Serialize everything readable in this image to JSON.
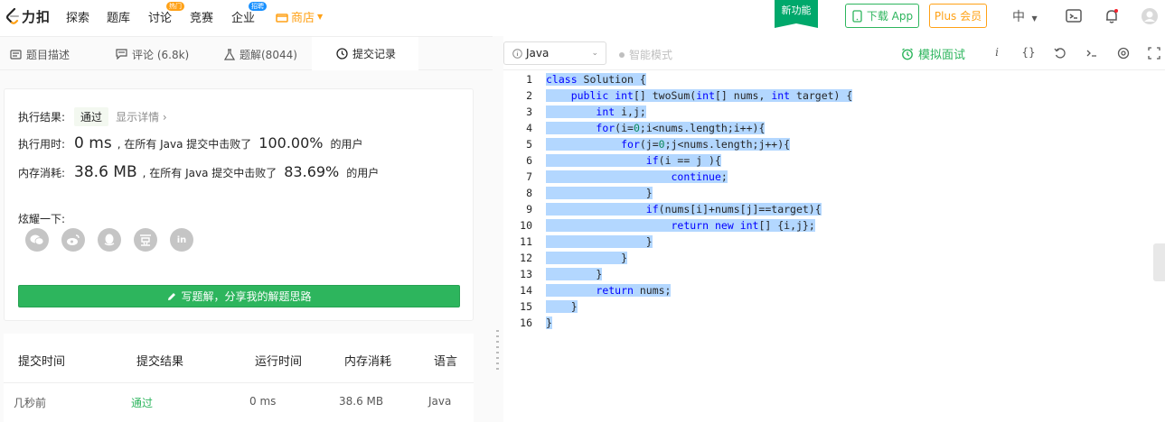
{
  "nav": {
    "logo_text": "力扣",
    "items": [
      "探索",
      "题库",
      "讨论",
      "竞赛",
      "企业"
    ],
    "badges": {
      "discuss": "热门",
      "company": "招聘"
    },
    "shop": "商店",
    "new_feature": "新功能",
    "download": "下载 App",
    "plus": "Plus 会员",
    "lang": "中"
  },
  "left_tabs": [
    {
      "label": "题目描述"
    },
    {
      "label": "评论 (6.8k)"
    },
    {
      "label": "题解(8044)"
    },
    {
      "label": "提交记录"
    }
  ],
  "result": {
    "exec_label": "执行结果:",
    "status": "通过",
    "detail": "显示详情 ›",
    "time_label": "执行用时:",
    "time_value": "0 ms",
    "time_mid": ", 在所有 Java 提交中击败了",
    "time_pct": "100.00%",
    "time_suffix": "的用户",
    "mem_label": "内存消耗:",
    "mem_value": "38.6 MB",
    "mem_mid": ", 在所有 Java 提交中击败了",
    "mem_pct": "83.69%",
    "mem_suffix": "的用户",
    "share_label": "炫耀一下:",
    "share_icons": [
      "wechat",
      "weibo",
      "qq",
      "douban",
      "linkedin"
    ],
    "share_in_text": "in",
    "write_btn": "写题解，分享我的解题思路"
  },
  "table": {
    "headers": [
      "提交时间",
      "提交结果",
      "运行时间",
      "内存消耗",
      "语言"
    ],
    "rows": [
      [
        "几秒前",
        "通过",
        "0 ms",
        "38.6 MB",
        "Java"
      ]
    ]
  },
  "editor_toolbar": {
    "language": "Java",
    "smart_mode": "智能模式",
    "mock": "模拟面试",
    "icons": [
      "info-icon",
      "braces-icon",
      "reset-icon",
      "console-icon",
      "settings-icon",
      "fullscreen-icon"
    ]
  },
  "code": {
    "line_numbers": [
      "1",
      "2",
      "3",
      "4",
      "5",
      "6",
      "7",
      "8",
      "9",
      "10",
      "11",
      "12",
      "13",
      "14",
      "15",
      "16"
    ],
    "lines": [
      "class Solution {",
      "    public int[] twoSum(int[] nums, int target) {",
      "        int i,j;",
      "        for(i=0;i<nums.length;i++){",
      "            for(j=0;j<nums.length;j++){",
      "                if(i == j ){",
      "                    continue;",
      "                }",
      "                if(nums[i]+nums[j]==target){",
      "                    return new int[] {i,j};",
      "                }",
      "            }",
      "        }",
      "        return nums;",
      "    }",
      "}"
    ]
  },
  "colors": {
    "accent": "#2db55d",
    "orange": "#ffa116",
    "selection": "#b3d7ff"
  }
}
